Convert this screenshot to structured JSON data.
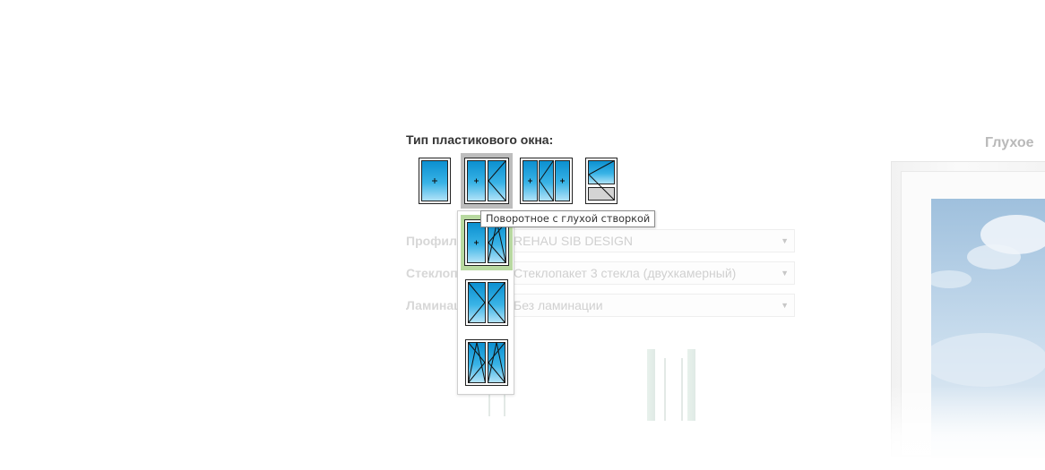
{
  "section_title": "Тип пластикового окна:",
  "window_types": [
    {
      "id": "single",
      "icon": "single-sash-window-icon"
    },
    {
      "id": "double",
      "icon": "double-sash-window-icon",
      "selected": true
    },
    {
      "id": "triple",
      "icon": "triple-sash-window-icon"
    },
    {
      "id": "balcony",
      "icon": "balcony-door-icon"
    }
  ],
  "tooltip": "Поворотное с глухой створкой",
  "variants": [
    {
      "icon": "fixed-and-tilt-turn-sash-icon",
      "highlighted": true
    },
    {
      "icon": "two-turn-sashes-icon"
    },
    {
      "icon": "two-tilt-turn-sashes-icon"
    }
  ],
  "form": {
    "profile_label": "Профиль:",
    "profile_value": "REHAU SIB DESIGN",
    "glass_label": "Стеклопакет:",
    "glass_value": "Стеклопакет 3 стекла (двухкамерный)",
    "lamination_label": "Ламинация:",
    "lamination_value": "Без ламинации"
  },
  "preview": {
    "title": "Глухое"
  },
  "colors": {
    "glass_top": "#0087c9",
    "glass_bottom": "#aee1f7",
    "selected_bg": "#bdbdbd",
    "highlight_bg": "#b8d9a0"
  }
}
